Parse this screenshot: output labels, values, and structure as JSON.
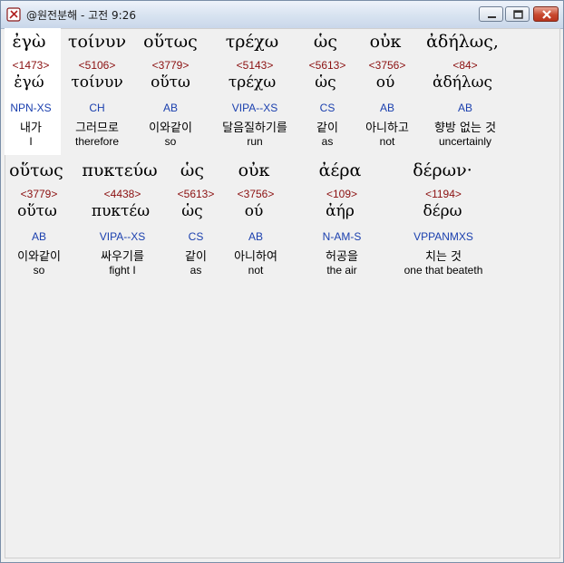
{
  "window": {
    "title": "@원전분해 - 고전 9:26"
  },
  "rows": [
    {
      "words": [
        {
          "greek": "ἐγὼ",
          "strong": "<1473>",
          "lemma": "ἐγώ",
          "parse": "NPN-XS",
          "korean": "내가",
          "english": "I"
        },
        {
          "greek": "τοίνυν",
          "strong": "<5106>",
          "lemma": "τοίνυν",
          "parse": "CH",
          "korean": "그러므로",
          "english": "therefore"
        },
        {
          "greek": "οὕτως",
          "strong": "<3779>",
          "lemma": "οὕτω",
          "parse": "AB",
          "korean": "이와같이",
          "english": "so"
        },
        {
          "greek": "τρέχω",
          "strong": "<5143>",
          "lemma": "τρέχω",
          "parse": "VIPA--XS",
          "korean": "달음질하기를",
          "english": "run"
        },
        {
          "greek": "ὡς",
          "strong": "<5613>",
          "lemma": "ὡς",
          "parse": "CS",
          "korean": "같이",
          "english": "as"
        },
        {
          "greek": "οὐκ",
          "strong": "<3756>",
          "lemma": "ού",
          "parse": "AB",
          "korean": "아니하고",
          "english": "not"
        },
        {
          "greek": "ἀδήλως,",
          "strong": "<84>",
          "lemma": "ἀδήλως",
          "parse": "AB",
          "korean": "향방 없는 것",
          "english": "uncertainly"
        }
      ]
    },
    {
      "words": [
        {
          "greek": "οὕτως",
          "strong": "<3779>",
          "lemma": "οὕτω",
          "parse": "AB",
          "korean": "이와같이",
          "english": "so"
        },
        {
          "greek": "πυκτεύω",
          "strong": "<4438>",
          "lemma": "πυκτέω",
          "parse": "VIPA--XS",
          "korean": "싸우기를",
          "english": "fight I"
        },
        {
          "greek": "ὡς",
          "strong": "<5613>",
          "lemma": "ὡς",
          "parse": "CS",
          "korean": "같이",
          "english": "as"
        },
        {
          "greek": "οὐκ",
          "strong": "<3756>",
          "lemma": "ού",
          "parse": "AB",
          "korean": "아니하여",
          "english": "not"
        },
        {
          "greek": "ἀέρα",
          "strong": "<109>",
          "lemma": "ἀήρ",
          "parse": "N-AM-S",
          "korean": "허공을",
          "english": "the air"
        },
        {
          "greek": "δέρων·",
          "strong": "<1194>",
          "lemma": "δέρω",
          "parse": "VPPANMXS",
          "korean": "치는 것",
          "english": "one that beateth"
        }
      ]
    }
  ]
}
